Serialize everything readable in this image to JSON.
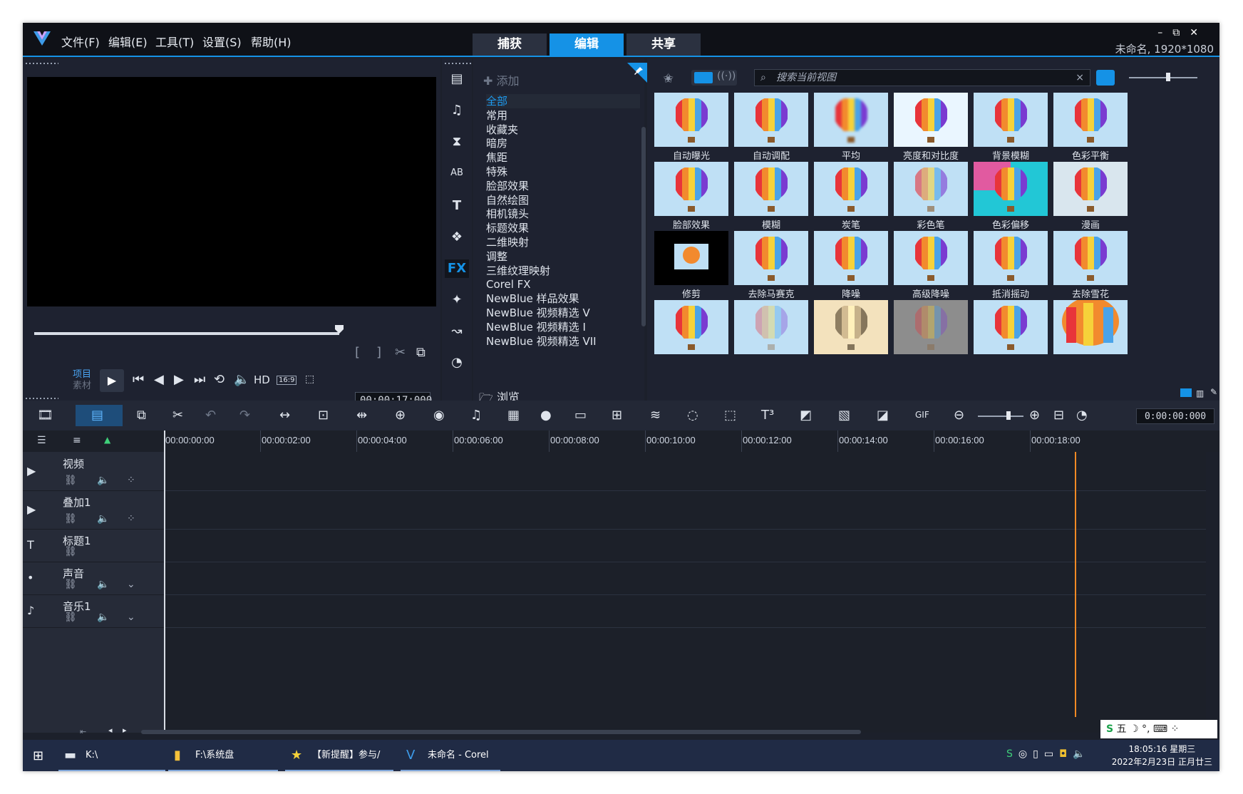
{
  "menu": [
    "文件(F)",
    "编辑(E)",
    "工具(T)",
    "设置(S)",
    "帮助(H)"
  ],
  "workspace_tabs": [
    {
      "label": "捕获",
      "active": false
    },
    {
      "label": "编辑",
      "active": true
    },
    {
      "label": "共享",
      "active": false
    }
  ],
  "window_controls": {
    "minimize": "–",
    "restore": "⧉",
    "close": "✕"
  },
  "project_info": "未命名, 1920*1080",
  "preview": {
    "mode_project": "项目",
    "mode_clip": "素材",
    "hd_label": "HD",
    "aspect_label": "16:9",
    "timecode": "00:00:17:000"
  },
  "library": {
    "add_label": "添加",
    "categories": [
      "全部",
      "常用",
      "收藏夹",
      "暗房",
      "焦距",
      "特殊",
      "脸部效果",
      "自然绘图",
      "相机镜头",
      "标题效果",
      "二维映射",
      "调整",
      "三维纹理映射",
      "Corel FX",
      "NewBlue 样品效果",
      "NewBlue 视频精选 V",
      "NewBlue 视频精选 I",
      "NewBlue 视频精选 VII"
    ],
    "selected_category": "全部",
    "browse_label": "浏览",
    "search_placeholder": "搜索当前视图",
    "side_icons": [
      "media-icon",
      "instant-project-icon",
      "transition-icon",
      "title-icon",
      "text-icon",
      "graphics-icon",
      "fx-icon",
      "motion-icon",
      "path-icon",
      "speed-icon"
    ],
    "fx_label": "FX"
  },
  "effects": [
    {
      "label": "自动曝光",
      "style": "normal"
    },
    {
      "label": "自动调配",
      "style": "normal"
    },
    {
      "label": "平均",
      "style": "blur"
    },
    {
      "label": "亮度和对比度",
      "style": "bright"
    },
    {
      "label": "背景模糊",
      "style": "normal"
    },
    {
      "label": "色彩平衡",
      "style": "normal"
    },
    {
      "label": "脸部效果",
      "style": "normal"
    },
    {
      "label": "模糊",
      "style": "normal"
    },
    {
      "label": "炭笔",
      "style": "normal"
    },
    {
      "label": "彩色笔",
      "style": "pale"
    },
    {
      "label": "色彩偏移",
      "style": "shift"
    },
    {
      "label": "漫画",
      "style": "comic"
    },
    {
      "label": "修剪",
      "style": "crop"
    },
    {
      "label": "去除马赛克",
      "style": "normal"
    },
    {
      "label": "降噪",
      "style": "normal"
    },
    {
      "label": "高级降噪",
      "style": "normal"
    },
    {
      "label": "抵消摇动",
      "style": "normal"
    },
    {
      "label": "去除雪花",
      "style": "normal"
    },
    {
      "label": "",
      "style": "glow"
    },
    {
      "label": "",
      "style": "fade"
    },
    {
      "label": "",
      "style": "sepia"
    },
    {
      "label": "",
      "style": "outline"
    },
    {
      "label": "",
      "style": "normal"
    },
    {
      "label": "",
      "style": "zoom"
    }
  ],
  "timeline": {
    "time_display": "0:00:00:000",
    "ruler": [
      "00:00:00:00",
      "00:00:02:00",
      "00:00:04:00",
      "00:00:06:00",
      "00:00:08:00",
      "00:00:10:00",
      "00:00:12:00",
      "00:00:14:00",
      "00:00:16:00",
      "00:00:18:00"
    ],
    "tracks": [
      {
        "name": "视频",
        "icon": "video-track-icon"
      },
      {
        "name": "叠加1",
        "icon": "overlay-track-icon"
      },
      {
        "name": "标题1",
        "icon": "title-track-icon"
      },
      {
        "name": "声音",
        "icon": "voice-track-icon"
      },
      {
        "name": "音乐1",
        "icon": "music-track-icon"
      }
    ]
  },
  "taskbar": {
    "items": [
      {
        "label": "K:\\",
        "icon": "drive-icon"
      },
      {
        "label": "F:\\系统盘",
        "icon": "folder-icon"
      },
      {
        "label": "【新提醒】参与/回...",
        "icon": "star-app-icon"
      },
      {
        "label": "未命名 - Corel Vid...",
        "icon": "corel-icon"
      }
    ],
    "ime": "五",
    "time": "18:05:16 星期三",
    "date": "2022年2月23日 正月廿三"
  },
  "colors": {
    "accent": "#1592e6",
    "playhead": "#f08a24",
    "background": "#1c202b"
  }
}
